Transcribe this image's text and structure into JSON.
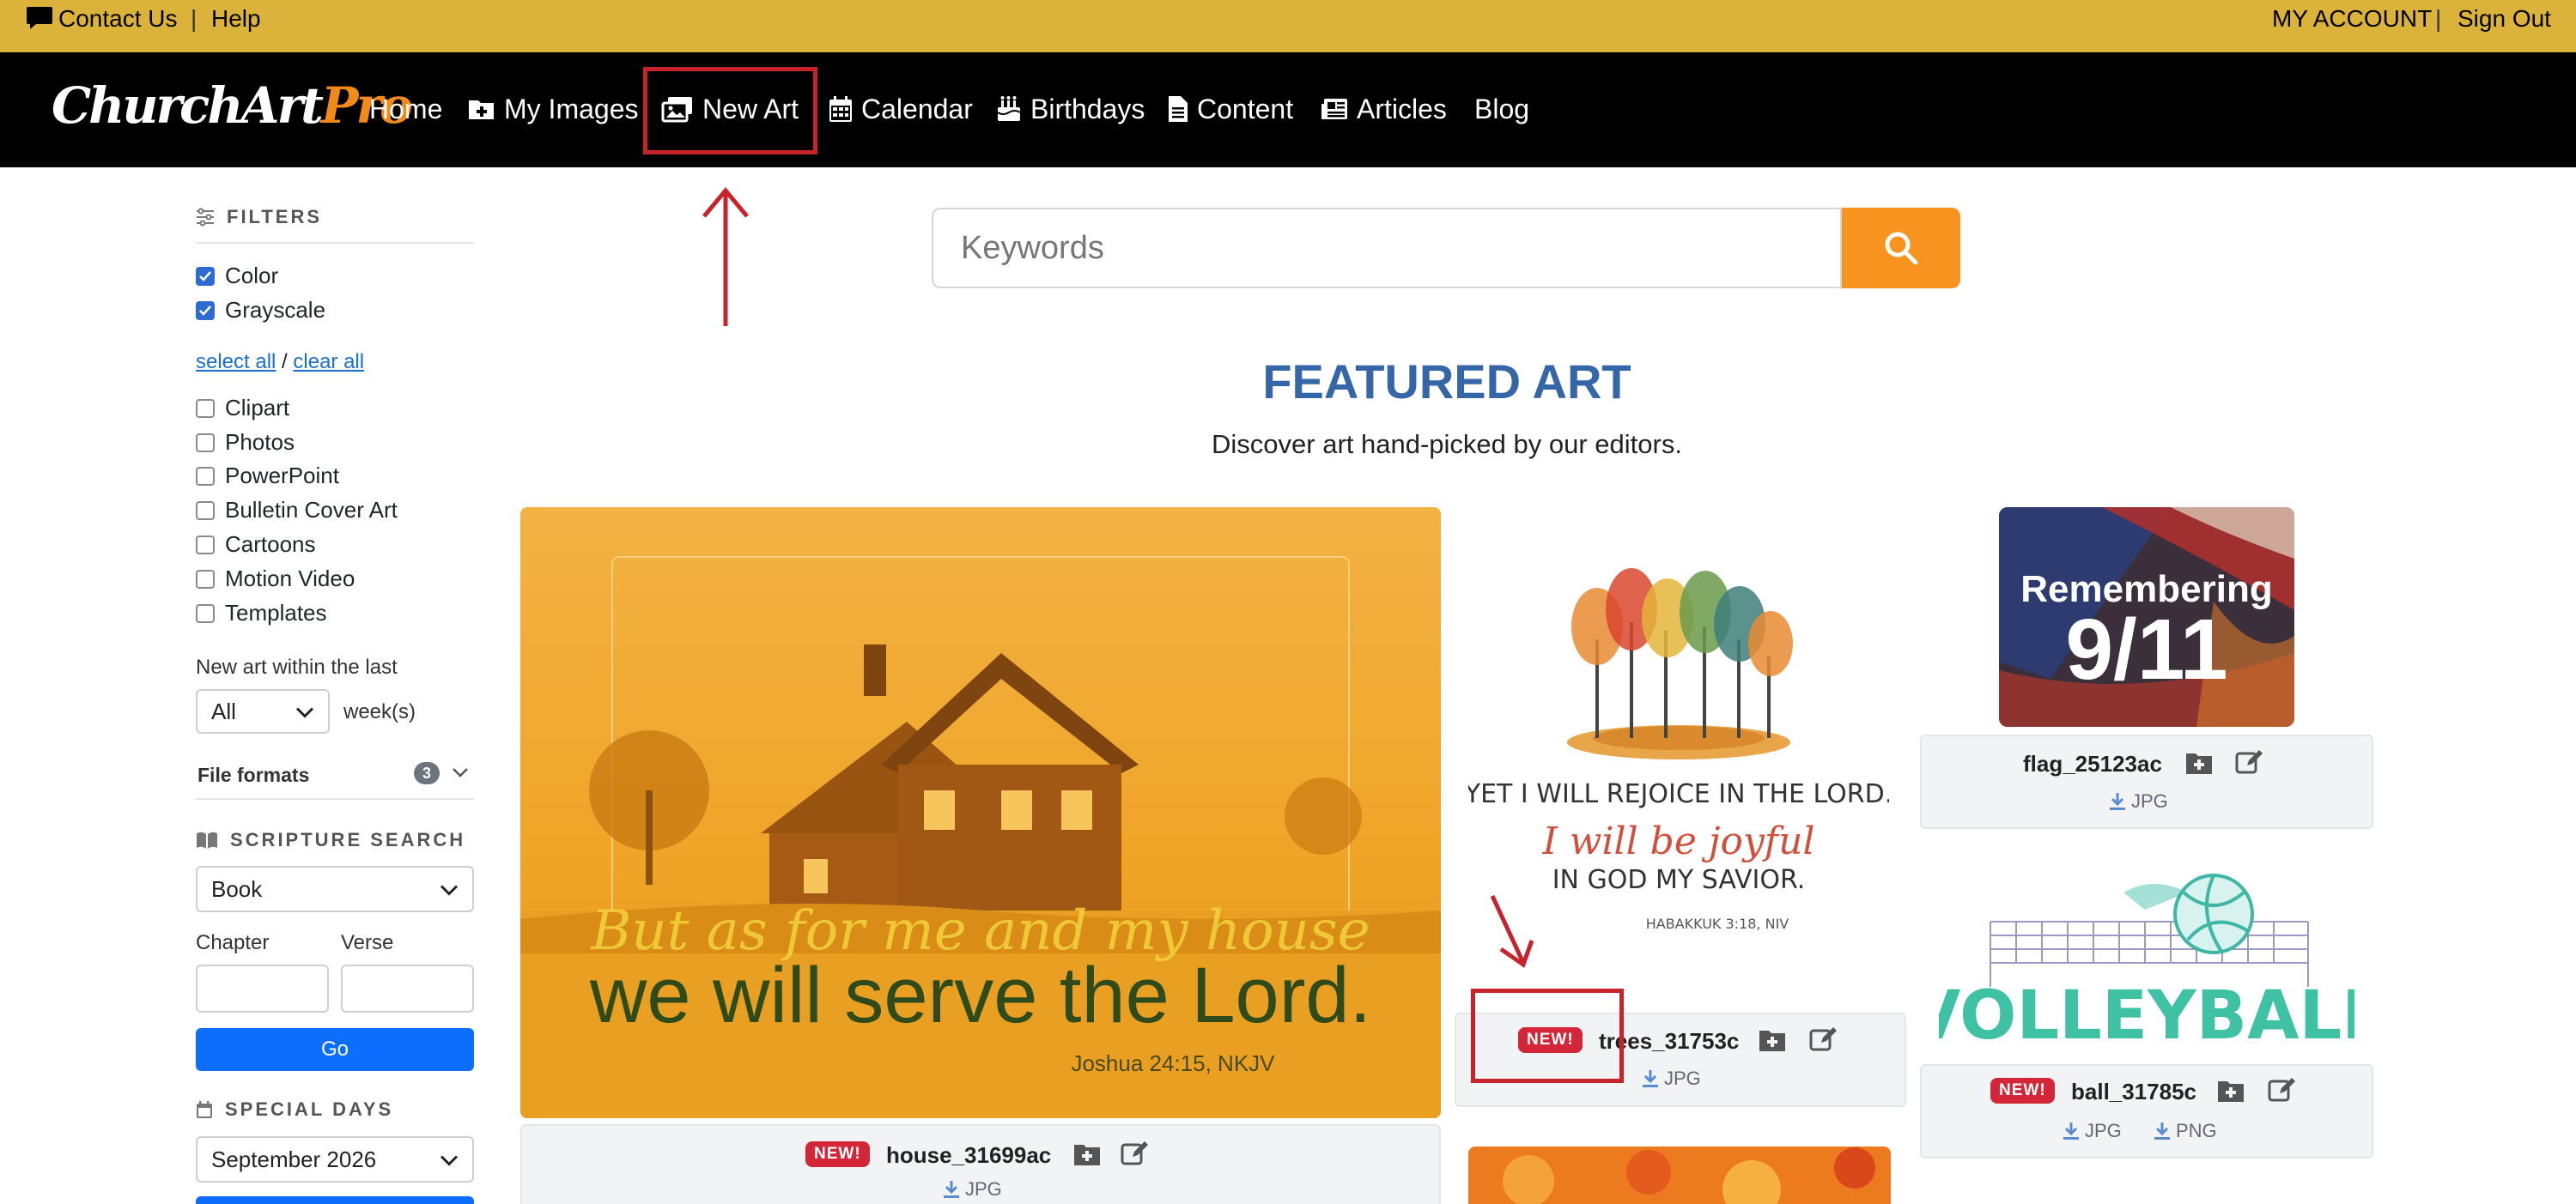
{
  "topbar": {
    "contact": "Contact Us",
    "sep1": "|",
    "help": "Help",
    "account": "MY ACCOUNT",
    "sep2": "|",
    "signout": "Sign Out"
  },
  "nav": {
    "logo_main": "ChurchArt",
    "logo_pro": "Pro",
    "items": [
      {
        "label": "Home"
      },
      {
        "label": "My Images"
      },
      {
        "label": "New Art"
      },
      {
        "label": "Calendar"
      },
      {
        "label": "Birthdays"
      },
      {
        "label": "Content"
      },
      {
        "label": "Articles"
      },
      {
        "label": "Blog"
      }
    ]
  },
  "sidebar": {
    "filters_title": "FILTERS",
    "color_filters": [
      {
        "label": "Color",
        "checked": true
      },
      {
        "label": "Grayscale",
        "checked": true
      }
    ],
    "select_all": "select all",
    "slash": "/",
    "clear_all": "clear all",
    "types": [
      {
        "label": "Clipart"
      },
      {
        "label": "Photos"
      },
      {
        "label": "PowerPoint"
      },
      {
        "label": "Bulletin Cover Art"
      },
      {
        "label": "Cartoons"
      },
      {
        "label": "Motion Video"
      },
      {
        "label": "Templates"
      }
    ],
    "new_art_label": "New art within the last",
    "new_art_value": "All",
    "new_art_unit": "week(s)",
    "file_formats_label": "File formats",
    "file_formats_count": "3",
    "scripture_title": "SCRIPTURE SEARCH",
    "book_value": "Book",
    "chapter_label": "Chapter",
    "verse_label": "Verse",
    "go_label": "Go",
    "special_days_title": "SPECIAL DAYS",
    "special_days_value": "September 2026"
  },
  "search": {
    "placeholder": "Keywords"
  },
  "featured": {
    "title": "FEATURED ART",
    "subtitle": "Discover art hand-picked by our editors."
  },
  "cards": {
    "house": {
      "name": "house_31699ac",
      "badge": "NEW!",
      "formats": [
        "JPG"
      ],
      "art_script": "But as for me and my house",
      "art_main": "we will serve the Lord.",
      "art_ref": "Joshua 24:15, NKJV"
    },
    "trees": {
      "name": "trees_31753c",
      "badge": "NEW!",
      "formats": [
        "JPG"
      ],
      "art_line1": "YET I WILL REJOICE IN THE LORD.",
      "art_line2": "I will be joyful",
      "art_line3": "IN GOD MY SAVIOR.",
      "art_ref": "HABAKKUK 3:18, NIV"
    },
    "flag": {
      "name": "flag_25123ac",
      "formats": [
        "JPG"
      ],
      "art_line1": "Remembering",
      "art_line2": "9/11"
    },
    "ball": {
      "name": "ball_31785c",
      "badge": "NEW!",
      "formats": [
        "JPG",
        "PNG"
      ],
      "art_text": "VOLLEYBALL"
    }
  },
  "colors": {
    "topbar": "#dbb23a",
    "nav": "#000000",
    "accent_orange": "#f7931e",
    "title_blue": "#3566a8",
    "annotation_red": "#c8232a",
    "new_badge": "#d32638"
  }
}
